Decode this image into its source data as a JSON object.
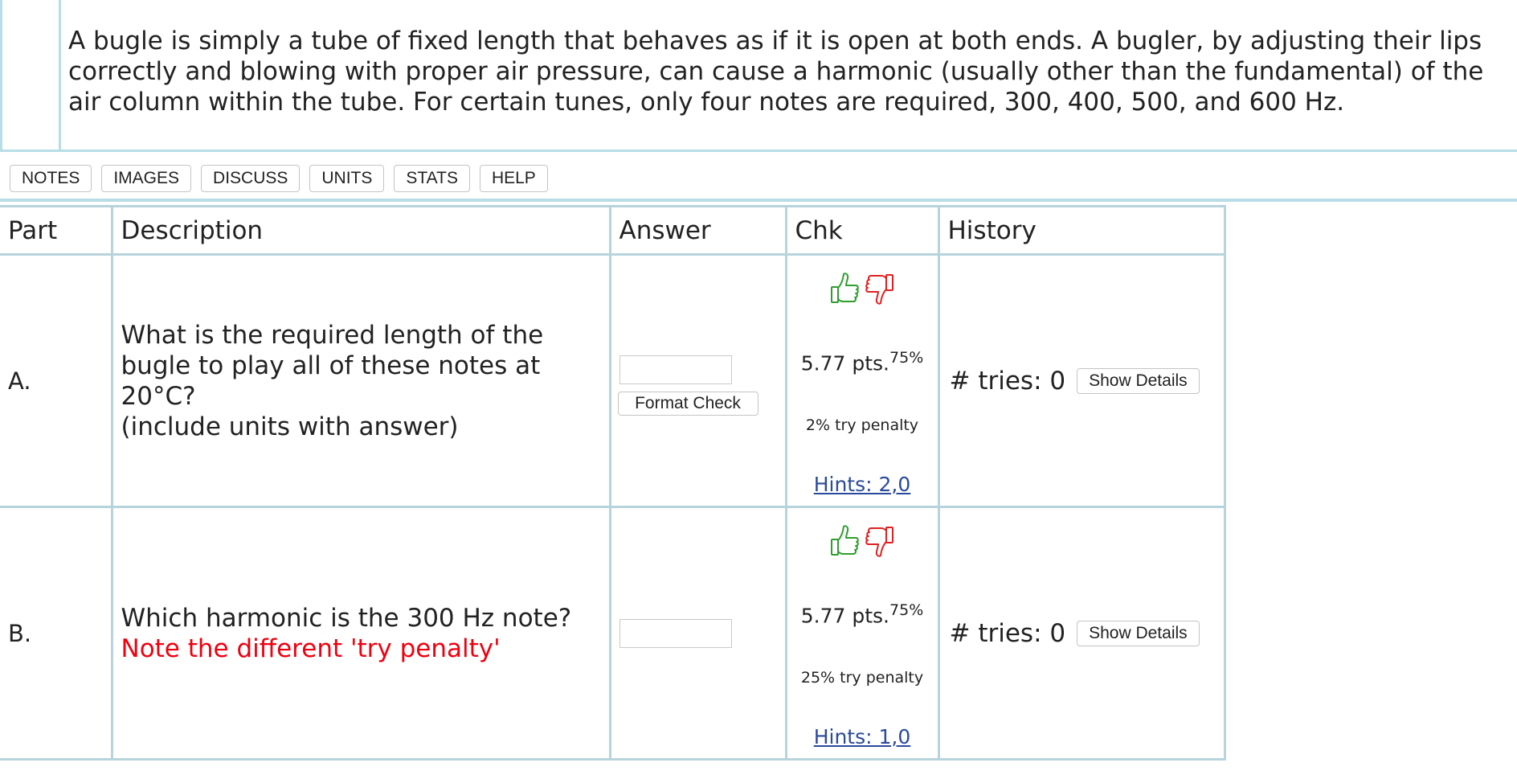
{
  "problem": {
    "text": "A bugle is simply a tube of fixed length that behaves as if it is open at both ends. A bugler, by adjusting their lips correctly and blowing with proper air pressure, can cause a harmonic (usually other than the fundamental) of the air column within the tube. For certain tunes, only four notes are required, 300, 400, 500, and 600 Hz."
  },
  "toolbar": [
    "NOTES",
    "IMAGES",
    "DISCUSS",
    "UNITS",
    "STATS",
    "HELP"
  ],
  "table": {
    "headers": {
      "part": "Part",
      "description": "Description",
      "answer": "Answer",
      "chk": "Chk",
      "history": "History"
    },
    "rows": [
      {
        "part": "A.",
        "description_lines": [
          "What is the required length of the",
          "bugle to play all of these notes at",
          "20°C?",
          "(include units with answer)"
        ],
        "note": "",
        "answer_value": "",
        "format_check": "Format Check",
        "points": "5.77 pts.",
        "percent": "75%",
        "penalty": "2% try penalty",
        "hints": "Hints: 2,0",
        "tries": "# tries: 0",
        "show_details": "Show Details"
      },
      {
        "part": "B.",
        "description_lines": [
          "Which harmonic is the 300 Hz note?"
        ],
        "note": "Note the different 'try penalty'",
        "answer_value": "",
        "format_check": "",
        "points": "5.77 pts.",
        "percent": "75%",
        "penalty": "25% try penalty",
        "hints": "Hints: 1,0",
        "tries": "# tries: 0",
        "show_details": "Show Details"
      }
    ]
  },
  "icons": {
    "thumb_up": "thumbs-up-icon",
    "thumb_down": "thumbs-down-icon"
  },
  "colors": {
    "accent_border": "#b7dde6",
    "thumb_up": "#2e9e2e",
    "thumb_down": "#e02020",
    "note_red": "#f0000f",
    "link": "#2a4a9a"
  }
}
